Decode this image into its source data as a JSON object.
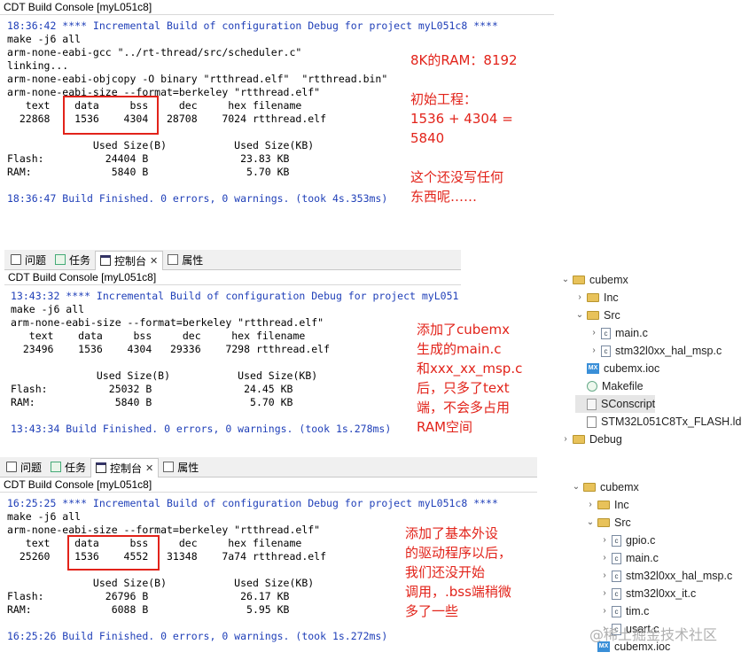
{
  "panel1": {
    "title": "CDT Build Console [myL051c8]",
    "lines": [
      "18:36:42 **** Incremental Build of configuration Debug for project myL051c8 ****",
      "make -j6 all",
      "arm-none-eabi-gcc \"../rt-thread/src/scheduler.c\"",
      "linking...",
      "arm-none-eabi-objcopy -O binary \"rtthread.elf\"  \"rtthread.bin\"",
      "arm-none-eabi-size --format=berkeley \"rtthread.elf\"",
      "   text    data     bss     dec     hex filename",
      "  22868    1536    4304   28708    7024 rtthread.elf",
      "",
      "              Used Size(B)           Used Size(KB)",
      "Flash:          24404 B               23.83 KB",
      "RAM:             5840 B                5.70 KB",
      "",
      "18:36:47 Build Finished. 0 errors, 0 warnings. (took 4s.353ms)"
    ],
    "note": "8K的RAM：8192\n\n初始工程：\n1536 + 4304 =\n5840\n\n这个还没写任何\n东西呢……"
  },
  "tabs": {
    "problems": "问题",
    "tasks": "任务",
    "console": "控制台",
    "properties": "属性",
    "close": "✕"
  },
  "panel2": {
    "title": "CDT Build Console [myL051c8]",
    "lines": [
      "13:43:32 **** Incremental Build of configuration Debug for project myL051",
      "make -j6 all",
      "arm-none-eabi-size --format=berkeley \"rtthread.elf\"",
      "   text    data     bss     dec     hex filename",
      "  23496    1536    4304   29336    7298 rtthread.elf",
      "",
      "              Used Size(B)           Used Size(KB)",
      "Flash:          25032 B               24.45 KB",
      "RAM:             5840 B                5.70 KB",
      "",
      "13:43:34 Build Finished. 0 errors, 0 warnings. (took 1s.278ms)"
    ],
    "note": "添加了cubemx\n生成的main.c\n和xxx_xx_msp.c\n后，只多了text\n端，不会多占用\nRAM空间"
  },
  "panel3": {
    "title": "CDT Build Console [myL051c8]",
    "lines": [
      "16:25:25 **** Incremental Build of configuration Debug for project myL051c8 ****",
      "make -j6 all",
      "arm-none-eabi-size --format=berkeley \"rtthread.elf\"",
      "   text    data     bss     dec     hex filename",
      "  25260    1536    4552   31348    7a74 rtthread.elf",
      "",
      "              Used Size(B)           Used Size(KB)",
      "Flash:          26796 B               26.17 KB",
      "RAM:             6088 B                5.95 KB",
      "",
      "16:25:26 Build Finished. 0 errors, 0 warnings. (took 1s.272ms)"
    ],
    "note": "添加了基本外设\n的驱动程序以后，\n我们还没开始\n调用，.bss端稍微\n多了一些"
  },
  "tree1": [
    {
      "label": "cubemx",
      "type": "folder",
      "arrow": "⌄",
      "indent": 0
    },
    {
      "label": "Inc",
      "type": "folder",
      "arrow": "›",
      "indent": 1
    },
    {
      "label": "Src",
      "type": "folder",
      "arrow": "⌄",
      "indent": 1
    },
    {
      "label": "main.c",
      "type": "cfile",
      "arrow": "›",
      "indent": 2
    },
    {
      "label": "stm32l0xx_hal_msp.c",
      "type": "cfile",
      "arrow": "›",
      "indent": 2
    },
    {
      "label": "cubemx.ioc",
      "type": "mx",
      "arrow": "",
      "indent": 1
    },
    {
      "label": "Makefile",
      "type": "mk",
      "arrow": "",
      "indent": 1
    },
    {
      "label": "SConscript",
      "type": "sc",
      "arrow": "",
      "indent": 1,
      "selected": true
    },
    {
      "label": "STM32L051C8Tx_FLASH.ld",
      "type": "ld",
      "arrow": "",
      "indent": 1
    },
    {
      "label": "Debug",
      "type": "folder",
      "arrow": "›",
      "indent": 0
    }
  ],
  "tree2": [
    {
      "label": "cubemx",
      "type": "folder",
      "arrow": "⌄",
      "indent": 0
    },
    {
      "label": "Inc",
      "type": "folder",
      "arrow": "›",
      "indent": 1
    },
    {
      "label": "Src",
      "type": "folder",
      "arrow": "⌄",
      "indent": 1
    },
    {
      "label": "gpio.c",
      "type": "cfile",
      "arrow": "›",
      "indent": 2
    },
    {
      "label": "main.c",
      "type": "cfile",
      "arrow": "›",
      "indent": 2
    },
    {
      "label": "stm32l0xx_hal_msp.c",
      "type": "cfile",
      "arrow": "›",
      "indent": 2
    },
    {
      "label": "stm32l0xx_it.c",
      "type": "cfile",
      "arrow": "›",
      "indent": 2
    },
    {
      "label": "tim.c",
      "type": "cfile",
      "arrow": "›",
      "indent": 2
    },
    {
      "label": "usart.c",
      "type": "cfile",
      "arrow": "›",
      "indent": 2
    },
    {
      "label": "cubemx.ioc",
      "type": "mx",
      "arrow": "",
      "indent": 1
    }
  ],
  "watermark": "@稀土掘金技术社区",
  "colors": {
    "accent_blue": "#1f3fb8",
    "annotation_red": "#e2231a"
  }
}
